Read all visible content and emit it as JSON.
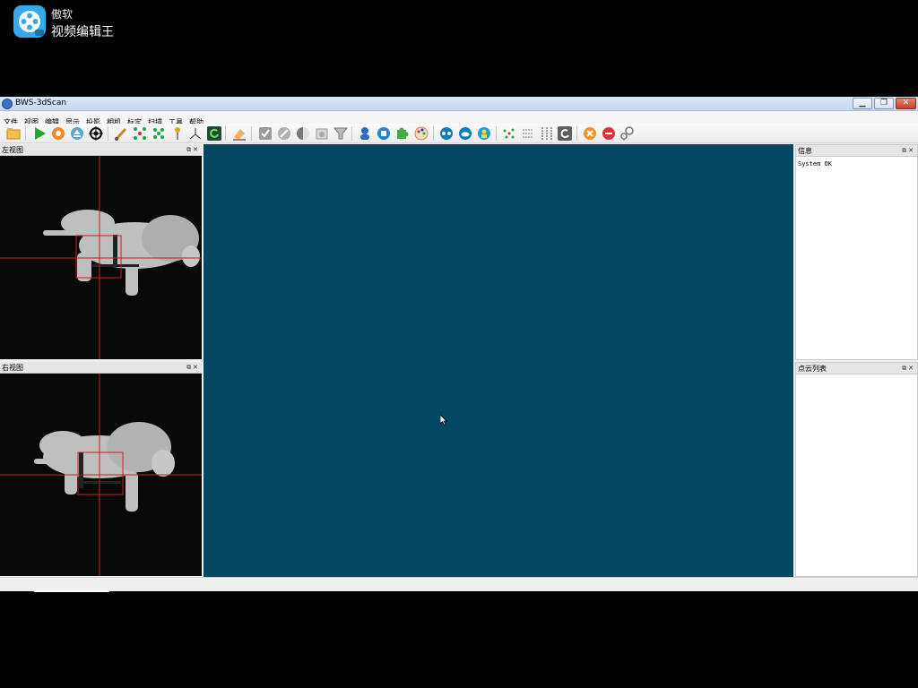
{
  "watermark": {
    "brand_top": "傲软",
    "brand_bottom": "视频编辑王",
    "icon": "film-reel-icon"
  },
  "window": {
    "title": "BWS-3dScan",
    "controls": [
      "minimize-icon",
      "restore-icon",
      "close-icon"
    ]
  },
  "menu": [
    "文件",
    "视图",
    "编辑",
    "显示",
    "投影",
    "相机",
    "标定",
    "扫描",
    "工具",
    "帮助"
  ],
  "toolbar_icons": [
    "open-folder-icon",
    "play-icon",
    "record-icon",
    "eject-icon",
    "target-icon",
    "brush-icon",
    "select-points-icon",
    "select-region-icon",
    "pin-icon",
    "axes-icon",
    "refresh-icon",
    "eraser-icon",
    "checkbox-icon",
    "disable-icon",
    "contrast-icon",
    "camera-icon",
    "filter-icon",
    "user-icon",
    "puzzle-blue-icon",
    "puzzle-green-icon",
    "palette-icon",
    "align-icon",
    "cloud-icon",
    "person-icon",
    "scatter-icon",
    "merge-icon",
    "grid-dots-icon",
    "rotate-icon",
    "stop-orange-icon",
    "stop-red-icon",
    "location-icon"
  ],
  "panels": {
    "left_view": {
      "title": "左视图"
    },
    "right_view": {
      "title": "右视图"
    },
    "info": {
      "title": "信息",
      "text": "System OK"
    },
    "cloud_list": {
      "title": "点云列表"
    }
  },
  "colors": {
    "viewport_bg": "#034863",
    "crosshair": "#c81e1e"
  }
}
